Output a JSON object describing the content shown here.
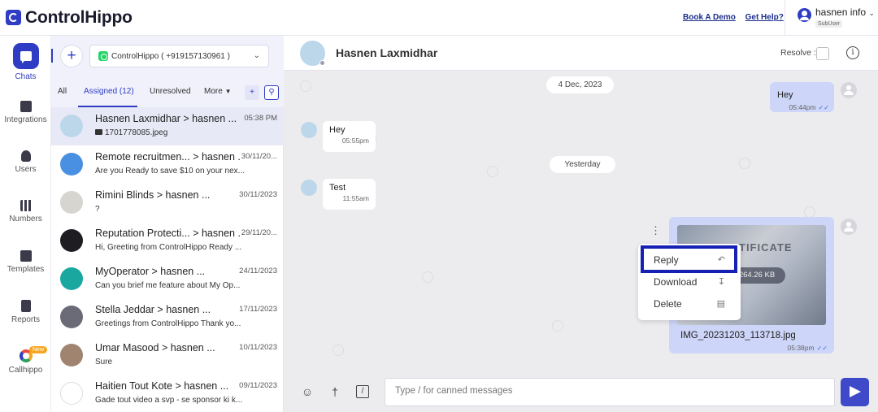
{
  "app": {
    "logo_text": "ControlHippo",
    "header_links": [
      "Book A Demo",
      "Get Help?"
    ],
    "user_name": "hasnen info",
    "user_role": "SubUser"
  },
  "nav": [
    {
      "label": "Chats",
      "icon": "chat-icon",
      "active": true
    },
    {
      "label": "Integrations",
      "icon": "integrations-icon"
    },
    {
      "label": "Users",
      "icon": "user-icon"
    },
    {
      "label": "Numbers",
      "icon": "qr-icon"
    },
    {
      "label": "Templates",
      "icon": "templates-icon"
    },
    {
      "label": "Reports",
      "icon": "reports-icon"
    },
    {
      "label": "Callhippo",
      "icon": "callhippo-icon",
      "badge": "New"
    }
  ],
  "list": {
    "channel": "ControlHippo ( +919157130961 )",
    "tabs": {
      "all": "All",
      "assigned": "Assigned (12)",
      "unresolved": "Unresolved",
      "more": "More"
    },
    "conversations": [
      {
        "name": "Hasnen Laxmidhar > hasnen ...",
        "time": "05:38 PM",
        "preview": "1701778085.jpeg",
        "avatar": "cartoon"
      },
      {
        "name": "Remote recruitmen... > hasnen ...",
        "time": "30/11/20...",
        "preview": "Are you Ready to save $10 on your nex...",
        "avatar": "default-blue"
      },
      {
        "name": "Rimini Blinds > hasnen ...",
        "time": "30/11/2023",
        "preview": "?",
        "avatar": "logo-gray"
      },
      {
        "name": "Reputation Protecti... > hasnen ...",
        "time": "29/11/20...",
        "preview": "Hi, Greeting from ControlHippo Ready ...",
        "avatar": "dark"
      },
      {
        "name": "MyOperator > hasnen ...",
        "time": "24/11/2023",
        "preview": "Can you brief me feature about My Op...",
        "avatar": "teal"
      },
      {
        "name": "Stella Jeddar > hasnen ...",
        "time": "17/11/2023",
        "preview": "Greetings from ControlHippo Thank yo...",
        "avatar": "default-gray"
      },
      {
        "name": "Umar Masood > hasnen ...",
        "time": "10/11/2023",
        "preview": "Sure",
        "avatar": "photo"
      },
      {
        "name": "Haitien Tout Kote > hasnen ...",
        "time": "09/11/2023",
        "preview": "Gade tout video a svp - se sponsor ki k...",
        "avatar": "htk"
      }
    ]
  },
  "chat": {
    "contact_name": "Hasnen Laxmidhar",
    "resolve_label": "Resolve :",
    "date1": "4 Dec, 2023",
    "date2": "Yesterday",
    "out1": {
      "text": "Hey",
      "time": "05:44pm"
    },
    "in1": {
      "text": "Hey",
      "time": "05:55pm"
    },
    "in2": {
      "text": "Test",
      "time": "11:55am"
    },
    "image_msg": {
      "overlay_text": "TIFICATE",
      "size": "264.26 KB",
      "filename": "IMG_20231203_113718.jpg",
      "time": "05:38pm"
    },
    "menu": [
      "Reply",
      "Download",
      "Delete"
    ],
    "composer_placeholder": "Type / for canned messages"
  },
  "colors": {
    "accent": "#2f3cc4",
    "highlight_border": "#1521b5",
    "outgoing_bubble": "#cdd5f8",
    "chat_bg": "#ececef"
  }
}
